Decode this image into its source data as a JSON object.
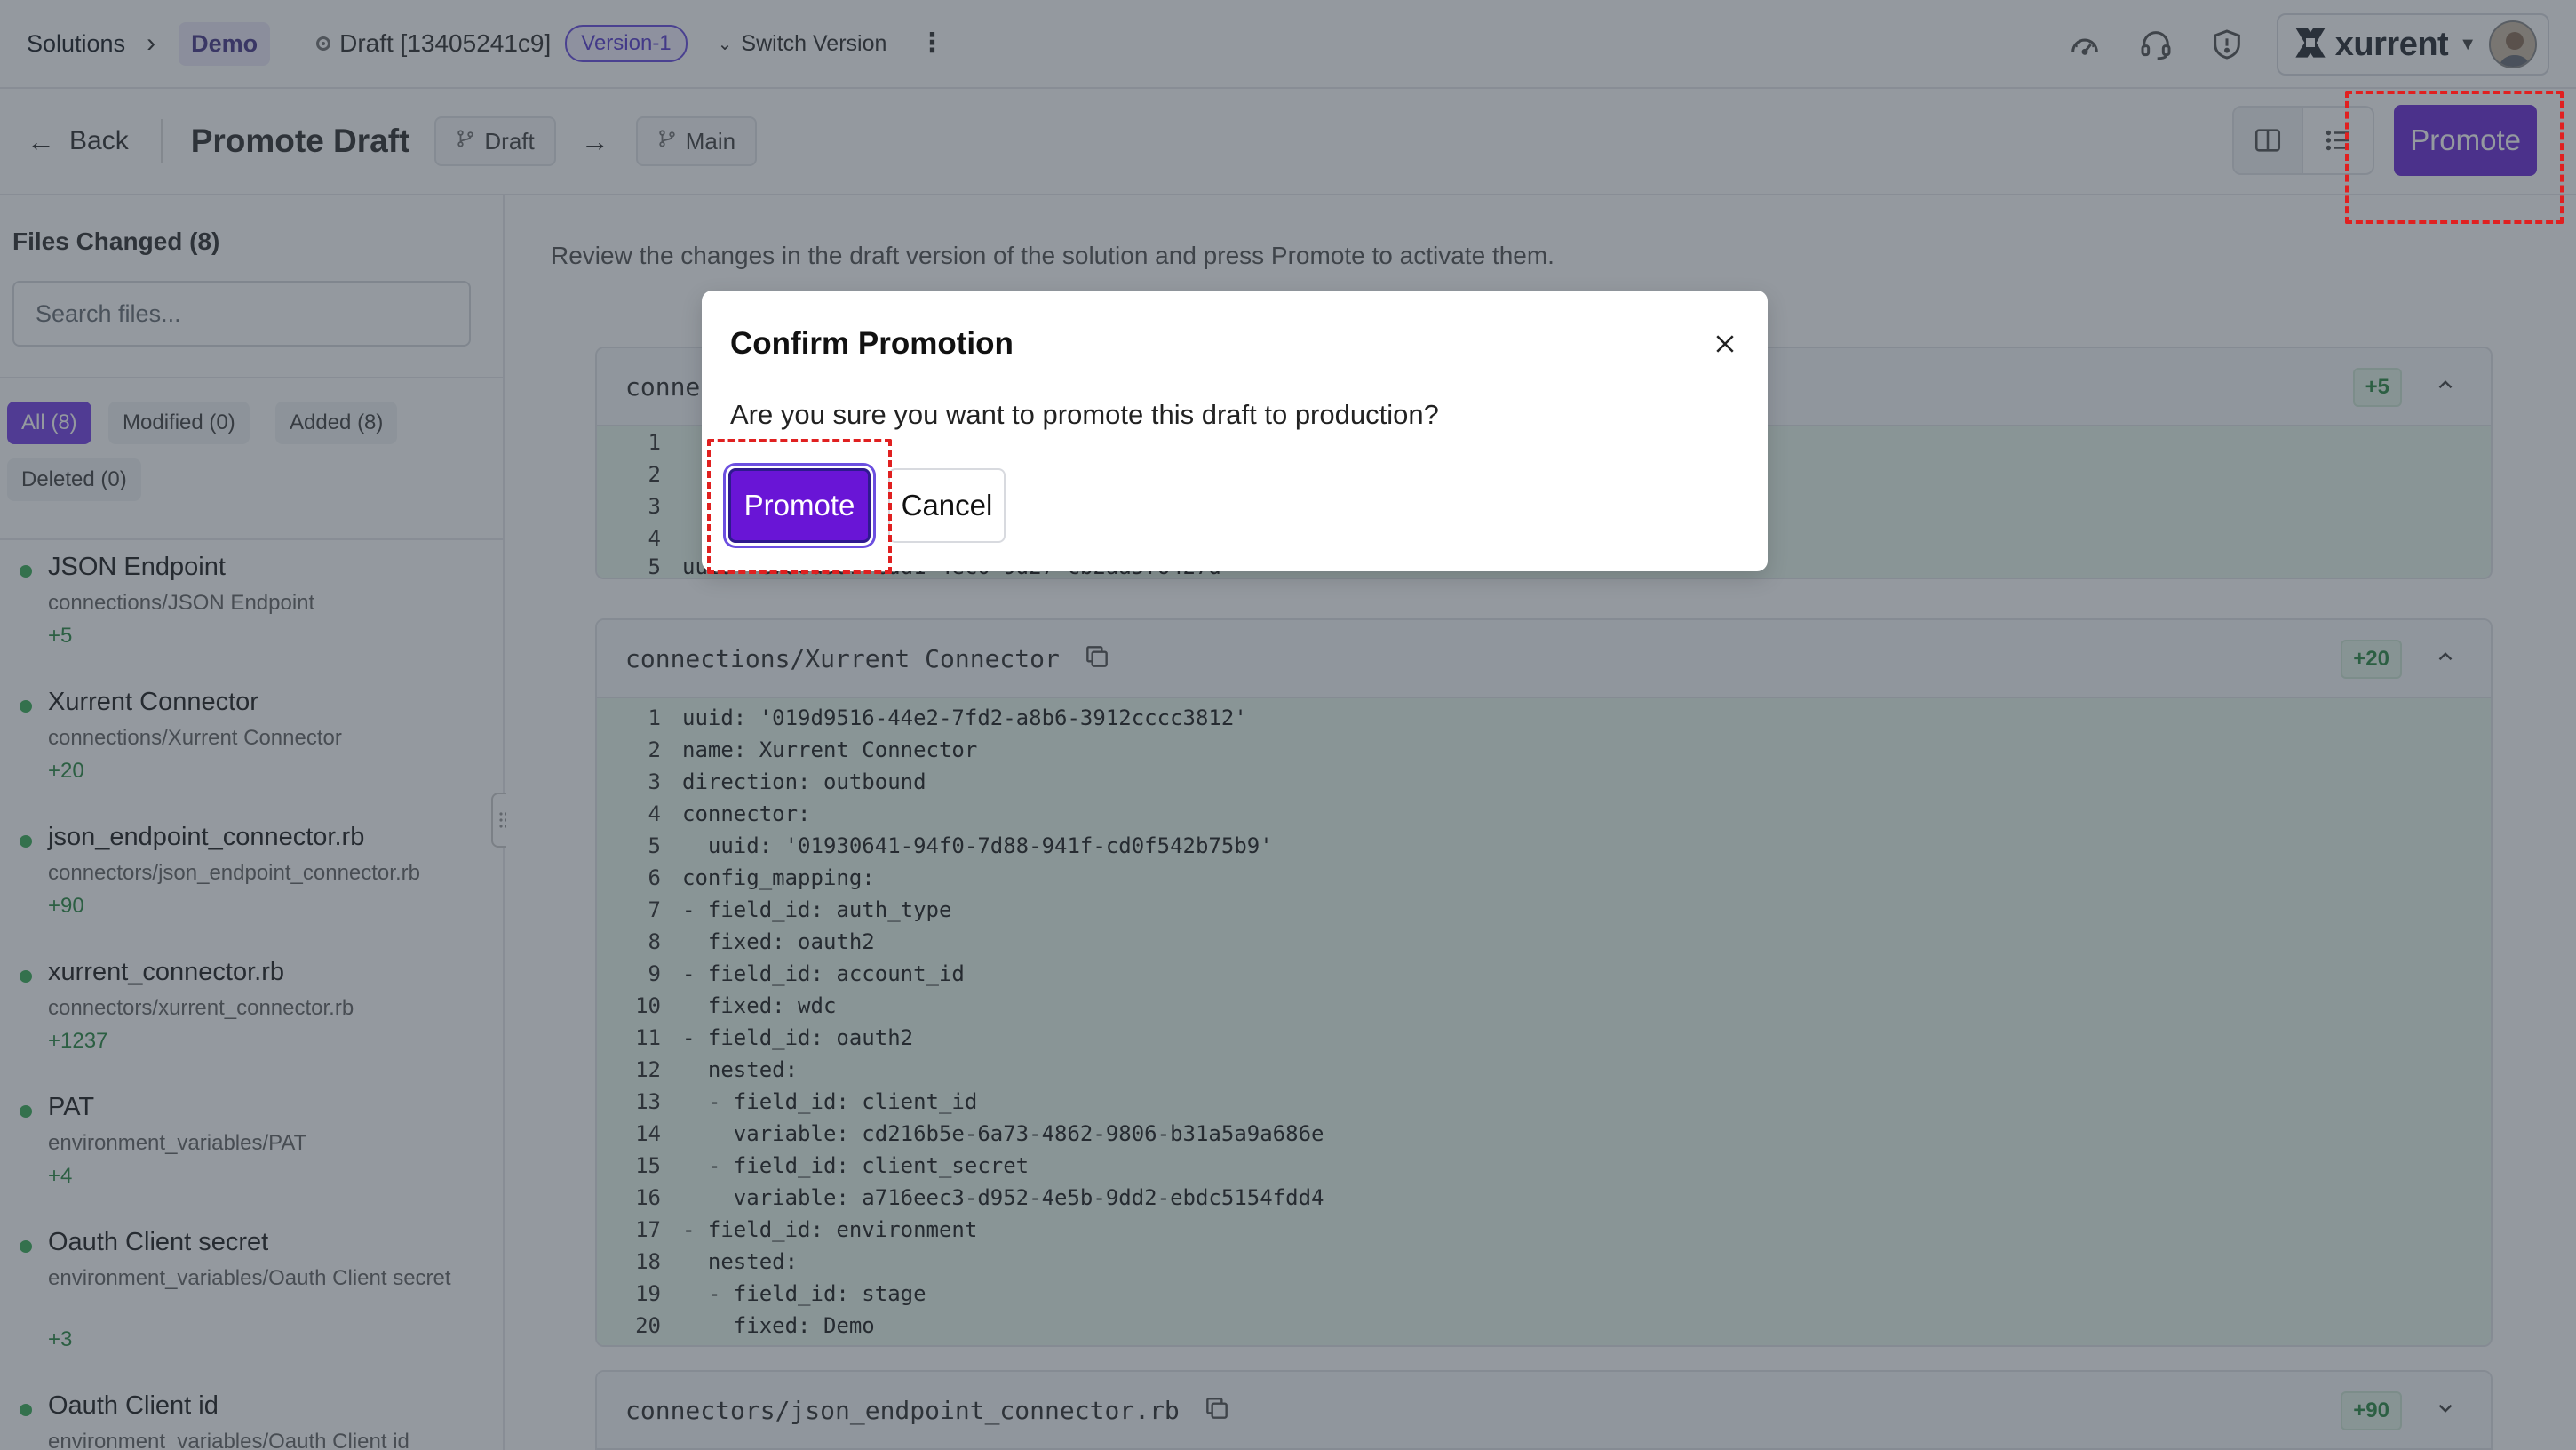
{
  "topbar": {
    "crumb_solutions": "Solutions",
    "crumb_demo": "Demo",
    "draft_label": "Draft [13405241c9]",
    "version_pill": "Version-1",
    "switch_version": "Switch Version",
    "brand": "xurrent"
  },
  "subbar": {
    "back": "Back",
    "title": "Promote Draft",
    "from_branch": "Draft",
    "to_branch": "Main",
    "promote": "Promote"
  },
  "sidebar": {
    "title": "Files Changed (8)",
    "search_placeholder": "Search files...",
    "filters": [
      "All (8)",
      "Modified (0)",
      "Added (8)",
      "Deleted (0)"
    ],
    "files": [
      {
        "name": "JSON Endpoint",
        "path": "connections/JSON Endpoint",
        "count": "+5"
      },
      {
        "name": "Xurrent Connector",
        "path": "connections/Xurrent Connector",
        "count": "+20"
      },
      {
        "name": "json_endpoint_connector.rb",
        "path": "connectors/json_endpoint_connector.rb",
        "count": "+90"
      },
      {
        "name": "xurrent_connector.rb",
        "path": "connectors/xurrent_connector.rb",
        "count": "+1237"
      },
      {
        "name": "PAT",
        "path": "environment_variables/PAT",
        "count": "+4"
      },
      {
        "name": "Oauth Client secret",
        "path": "environment_variables/Oauth Client secret",
        "count": "+3"
      },
      {
        "name": "Oauth Client id",
        "path": "environment_variables/Oauth Client id",
        "count": ""
      }
    ]
  },
  "main": {
    "description": "Review the changes in the draft version of the solution and press Promote to activate them.",
    "cards": [
      {
        "title": "conne",
        "badge": "+5",
        "lines": [
          {
            "n": "1",
            "t": ""
          },
          {
            "n": "2",
            "t": ""
          },
          {
            "n": "3",
            "t": ""
          },
          {
            "n": "4",
            "t": ""
          },
          {
            "n": "5",
            "t": "uuid: e7d8d5d1-cdd1-4ec0-9d27-cb2aa5f6427d"
          }
        ]
      },
      {
        "title": "connections/Xurrent Connector",
        "badge": "+20",
        "lines": [
          {
            "n": "1",
            "t": "uuid: '019d9516-44e2-7fd2-a8b6-3912cccc3812'"
          },
          {
            "n": "2",
            "t": "name: Xurrent Connector"
          },
          {
            "n": "3",
            "t": "direction: outbound"
          },
          {
            "n": "4",
            "t": "connector:"
          },
          {
            "n": "5",
            "t": "  uuid: '01930641-94f0-7d88-941f-cd0f542b75b9'"
          },
          {
            "n": "6",
            "t": "config_mapping:"
          },
          {
            "n": "7",
            "t": "- field_id: auth_type"
          },
          {
            "n": "8",
            "t": "  fixed: oauth2"
          },
          {
            "n": "9",
            "t": "- field_id: account_id"
          },
          {
            "n": "10",
            "t": "  fixed: wdc"
          },
          {
            "n": "11",
            "t": "- field_id: oauth2"
          },
          {
            "n": "12",
            "t": "  nested:"
          },
          {
            "n": "13",
            "t": "  - field_id: client_id"
          },
          {
            "n": "14",
            "t": "    variable: cd216b5e-6a73-4862-9806-b31a5a9a686e"
          },
          {
            "n": "15",
            "t": "  - field_id: client_secret"
          },
          {
            "n": "16",
            "t": "    variable: a716eec3-d952-4e5b-9dd2-ebdc5154fdd4"
          },
          {
            "n": "17",
            "t": "- field_id: environment"
          },
          {
            "n": "18",
            "t": "  nested:"
          },
          {
            "n": "19",
            "t": "  - field_id: stage"
          },
          {
            "n": "20",
            "t": "    fixed: Demo"
          }
        ]
      },
      {
        "title": "connectors/json_endpoint_connector.rb",
        "badge": "+90",
        "lines": []
      }
    ]
  },
  "modal": {
    "title": "Confirm Promotion",
    "text": "Are you sure you want to promote this draft to production?",
    "promote": "Promote",
    "cancel": "Cancel"
  },
  "colors": {
    "accent": "#6d2fd6",
    "added_bg": "#e9f7ec",
    "annotation": "#e02020"
  },
  "icons": [
    "chevron-right-icon",
    "draft-dot-icon",
    "chevron-down-icon",
    "kebab-icon",
    "dashboard-icon",
    "headset-icon",
    "shield-icon",
    "xurrent-logo-icon",
    "back-arrow-icon",
    "branch-icon",
    "arrow-right-icon",
    "split-view-icon",
    "list-view-icon",
    "copy-icon",
    "chevron-up-icon",
    "close-icon",
    "drag-handle-icon"
  ]
}
